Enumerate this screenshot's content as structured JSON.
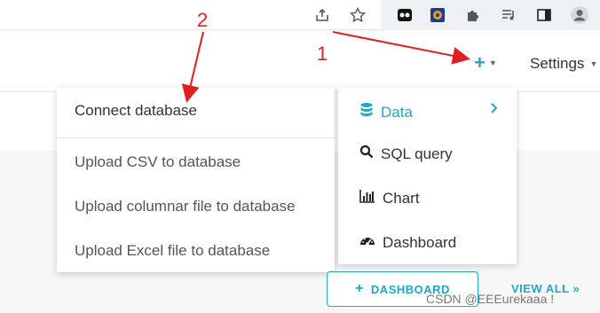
{
  "browser": {
    "icons": [
      "share-icon",
      "star-icon",
      "extension-icon-1",
      "extension-icon-2",
      "puzzle-icon",
      "media-icon",
      "sidebar-icon",
      "profile-icon"
    ]
  },
  "header": {
    "settings_label": "Settings"
  },
  "submenu": {
    "items": [
      {
        "label": "Connect database"
      },
      {
        "label": "Upload CSV to database"
      },
      {
        "label": "Upload columnar file to database"
      },
      {
        "label": "Upload Excel file to database"
      }
    ]
  },
  "mainmenu": {
    "items": [
      {
        "label": "Data",
        "icon": "database-icon"
      },
      {
        "label": "SQL query",
        "icon": "search-icon"
      },
      {
        "label": "Chart",
        "icon": "bar-chart-icon"
      },
      {
        "label": "Dashboard",
        "icon": "dashboard-icon"
      }
    ]
  },
  "buttons": {
    "dashboard_label": "DASHBOARD",
    "view_all_label": "VIEW ALL »"
  },
  "annotations": {
    "step1": "1",
    "step2": "2"
  },
  "watermark": "CSDN @EEEurekaaa !",
  "colors": {
    "accent": "#20a7c9",
    "annotation": "#e02020"
  }
}
